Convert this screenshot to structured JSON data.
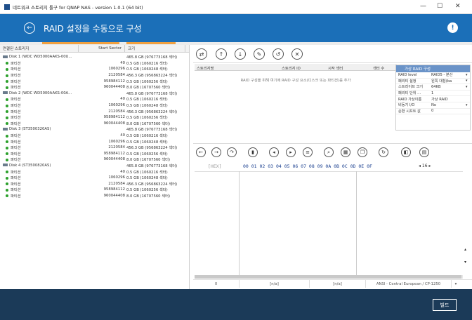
{
  "window": {
    "title": "네트워크 스토리지 툴구 for QNAP NAS - version 1.0.1 (64 bit)",
    "minimize": "—",
    "maximize": "☐",
    "close": "✕"
  },
  "header": {
    "title": "RAID 설정을 수동으로 구성",
    "back_icon": "←",
    "help_icon": "!"
  },
  "left": {
    "columns": [
      "연결된 스토리지",
      "Start Sector",
      "크기"
    ],
    "rows": [
      {
        "type": "disk",
        "name": "Disk 1 (WDC WD5000AAKS-00U...",
        "sector": "",
        "size": "465.8 GB (976773168 섹터)"
      },
      {
        "type": "part",
        "name": "파티션",
        "sector": "40",
        "size": "0.5 GB (1060216 섹터)"
      },
      {
        "type": "part",
        "name": "파티션",
        "sector": "1060296",
        "size": "0.5 GB (1060248 섹터)"
      },
      {
        "type": "part",
        "name": "파티션",
        "sector": "2120584",
        "size": "456.3 GB (956863224 섹터)"
      },
      {
        "type": "part",
        "name": "파티션",
        "sector": "958984112",
        "size": "0.5 GB (1060256 섹터)"
      },
      {
        "type": "part",
        "name": "파티션",
        "sector": "960044408",
        "size": "8.0 GB (16707560 섹터)"
      },
      {
        "type": "disk",
        "name": "Disk 2 (WDC WD5000AAKS-00A...",
        "sector": "",
        "size": "465.8 GB (976773168 섹터)"
      },
      {
        "type": "part",
        "name": "파티션",
        "sector": "40",
        "size": "0.5 GB (1060216 섹터)"
      },
      {
        "type": "part",
        "name": "파티션",
        "sector": "1060296",
        "size": "0.5 GB (1060248 섹터)"
      },
      {
        "type": "part",
        "name": "파티션",
        "sector": "2120584",
        "size": "456.3 GB (956863224 섹터)"
      },
      {
        "type": "part",
        "name": "파티션",
        "sector": "958984112",
        "size": "0.5 GB (1060256 섹터)"
      },
      {
        "type": "part",
        "name": "파티션",
        "sector": "960044408",
        "size": "8.0 GB (16707560 섹터)"
      },
      {
        "type": "disk",
        "name": "Disk 3 (ST3500320AS)",
        "sector": "",
        "size": "465.8 GB (976773168 섹터)"
      },
      {
        "type": "part",
        "name": "파티션",
        "sector": "40",
        "size": "0.5 GB (1060216 섹터)"
      },
      {
        "type": "part",
        "name": "파티션",
        "sector": "1060296",
        "size": "0.5 GB (1060248 섹터)"
      },
      {
        "type": "part",
        "name": "파티션",
        "sector": "2120584",
        "size": "456.3 GB (956863224 섹터)"
      },
      {
        "type": "part",
        "name": "파티션",
        "sector": "958984112",
        "size": "0.5 GB (1060256 섹터)"
      },
      {
        "type": "part",
        "name": "파티션",
        "sector": "960044408",
        "size": "8.0 GB (16707560 섹터)"
      },
      {
        "type": "disk",
        "name": "Disk 4 (ST3500820AS)",
        "sector": "",
        "size": "465.8 GB (976773168 섹터)"
      },
      {
        "type": "part",
        "name": "파티션",
        "sector": "40",
        "size": "0.5 GB (1060216 섹터)"
      },
      {
        "type": "part",
        "name": "파티션",
        "sector": "1060296",
        "size": "0.5 GB (1060248 섹터)"
      },
      {
        "type": "part",
        "name": "파티션",
        "sector": "2120584",
        "size": "456.3 GB (956863224 섹터)"
      },
      {
        "type": "part",
        "name": "파티션",
        "sector": "958984112",
        "size": "0.5 GB (1060256 섹터)"
      },
      {
        "type": "part",
        "name": "파티션",
        "sector": "960044408",
        "size": "8.0 GB (16707560 섹터)"
      }
    ]
  },
  "toolbar": {
    "icons": [
      "⇄",
      "↑",
      "↓",
      "✎",
      "↺",
      "✕"
    ]
  },
  "storage_grid": {
    "col1": "스토리지명",
    "col2": "스토리지 ID",
    "col3": "시작 섹터",
    "col4": "섹터 수",
    "hint": "RAID 구성을 위해 여기에 RAID 구성 요소(디스크 또는 파티션)를 추가"
  },
  "virtual_raid": {
    "title": "가상 RAID 구성",
    "rows": [
      {
        "k": "RAID level",
        "v": "RAID5 - 분산",
        "dd": "▾"
      },
      {
        "k": "패리티 설정",
        "v": "왼쪽 대칭(ba",
        "dd": "▾"
      },
      {
        "k": "스트라이프 크기",
        "v": "64KB",
        "dd": "▾"
      },
      {
        "k": "패리티 단위 ...",
        "v": "1",
        "dd": ""
      },
      {
        "k": "RAID 가상이름",
        "v": "가상 RAID",
        "dd": ""
      },
      {
        "k": "비동기 I/O",
        "v": "No",
        "dd": "▾"
      },
      {
        "k": "순환 시프트 값",
        "v": "0",
        "dd": ""
      }
    ]
  },
  "hex": {
    "label": "[HEX]",
    "columns": "00 01 02 03 04 05 06 07 08 09 0A 0B 0C 0D 0E 0F",
    "width": "◂ 16 ▸"
  },
  "status": {
    "offset": "0",
    "sel1": "[n/a]",
    "sel2": "[n/a]",
    "encoding": "ANSI - Central European / CP-1250",
    "dd": "▾"
  },
  "footer": {
    "build_label": "빌드"
  }
}
